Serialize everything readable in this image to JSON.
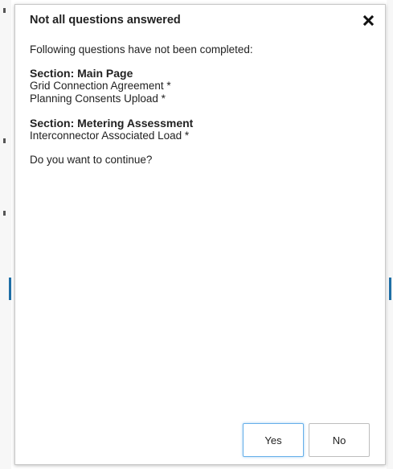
{
  "dialog": {
    "title": "Not all questions answered",
    "intro": "Following questions have not been completed:",
    "sections": [
      {
        "title": "Section: Main Page",
        "questions": [
          "Grid Connection Agreement *",
          "Planning Consents Upload *"
        ]
      },
      {
        "title": "Section: Metering Assessment",
        "questions": [
          "Interconnector Associated Load *"
        ]
      }
    ],
    "prompt": "Do you want to continue?",
    "close_icon": "close-icon",
    "yes_label": "Yes",
    "no_label": "No"
  },
  "colors": {
    "accent": "#66afe9",
    "background_edge_accent": "#1f6fa6"
  }
}
